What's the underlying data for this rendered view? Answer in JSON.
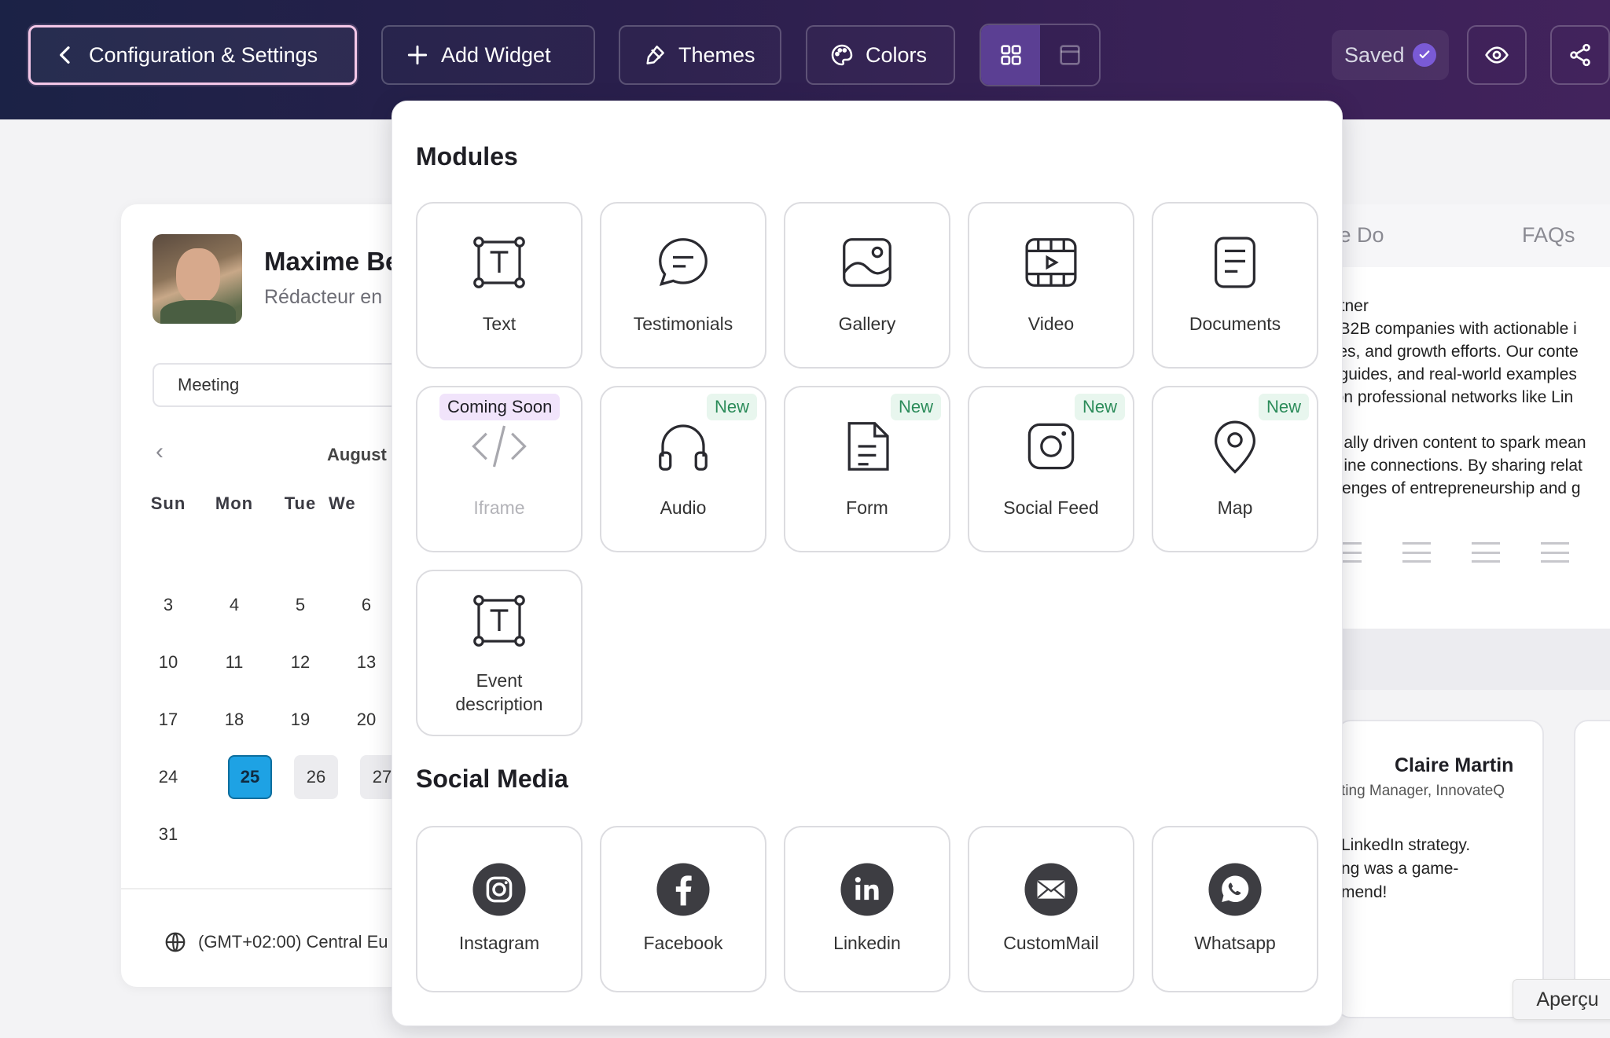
{
  "toolbar": {
    "config_label": "Configuration & Settings",
    "add_widget_label": "Add Widget",
    "themes_label": "Themes",
    "colors_label": "Colors",
    "saved_label": "Saved"
  },
  "profile": {
    "name": "Maxime Be",
    "role": "Rédacteur en"
  },
  "booking": {
    "meeting_value": "Meeting",
    "month": "August",
    "weekdays": [
      "Sun",
      "Mon",
      "Tue",
      "We"
    ],
    "days": [
      "3",
      "4",
      "5",
      "6",
      "10",
      "11",
      "12",
      "13",
      "17",
      "18",
      "19",
      "20",
      "24",
      "25",
      "26",
      "27",
      "31"
    ],
    "selected_day": "25",
    "timezone": "(GMT+02:00) Central Eu"
  },
  "right_card": {
    "tab_1": "/e Do",
    "tab_2": "FAQs",
    "lines": [
      "artner",
      "g B2B companies with actionable i",
      "ales, and growth efforts. Our conte",
      "d guides, and real-world examples",
      "t on professional networks like Lin",
      "onally driven content to spark mean",
      "nuine connections. By sharing relat",
      "allenges of entrepreneurship and g"
    ],
    "testimonial_name": "Claire Martin",
    "testimonial_role": "ting Manager, InnovateQ",
    "testimonial_quote": [
      "LinkedIn strategy.",
      "ng was a game-",
      "mend!"
    ],
    "apercu_label": "Aperçu"
  },
  "panel": {
    "modules_title": "Modules",
    "social_title": "Social Media",
    "modules": [
      {
        "label": "Text",
        "icon": "text-box-icon"
      },
      {
        "label": "Testimonials",
        "icon": "chat-bubble-icon"
      },
      {
        "label": "Gallery",
        "icon": "image-icon"
      },
      {
        "label": "Video",
        "icon": "film-icon"
      },
      {
        "label": "Documents",
        "icon": "document-icon"
      },
      {
        "label": "Iframe",
        "icon": "code-icon",
        "badge": "Coming Soon"
      },
      {
        "label": "Audio",
        "icon": "headphones-icon",
        "badge": "New"
      },
      {
        "label": "Form",
        "icon": "form-icon",
        "badge": "New"
      },
      {
        "label": "Social Feed",
        "icon": "instagram-outline-icon",
        "badge": "New"
      },
      {
        "label": "Map",
        "icon": "map-pin-icon",
        "badge": "New"
      },
      {
        "label": "Event description",
        "icon": "text-box-icon"
      }
    ],
    "social": [
      {
        "label": "Instagram",
        "icon": "instagram-icon"
      },
      {
        "label": "Facebook",
        "icon": "facebook-icon"
      },
      {
        "label": "Linkedin",
        "icon": "linkedin-icon"
      },
      {
        "label": "CustomMail",
        "icon": "mail-icon"
      },
      {
        "label": "Whatsapp",
        "icon": "whatsapp-icon"
      }
    ]
  },
  "colors": {
    "accent": "#5b3f93",
    "badge_new_text": "#2c8c5a",
    "badge_new_bg": "#e8f6ee",
    "badge_soon_bg": "#f1e4fb",
    "selected_day": "#1ea2e4"
  }
}
